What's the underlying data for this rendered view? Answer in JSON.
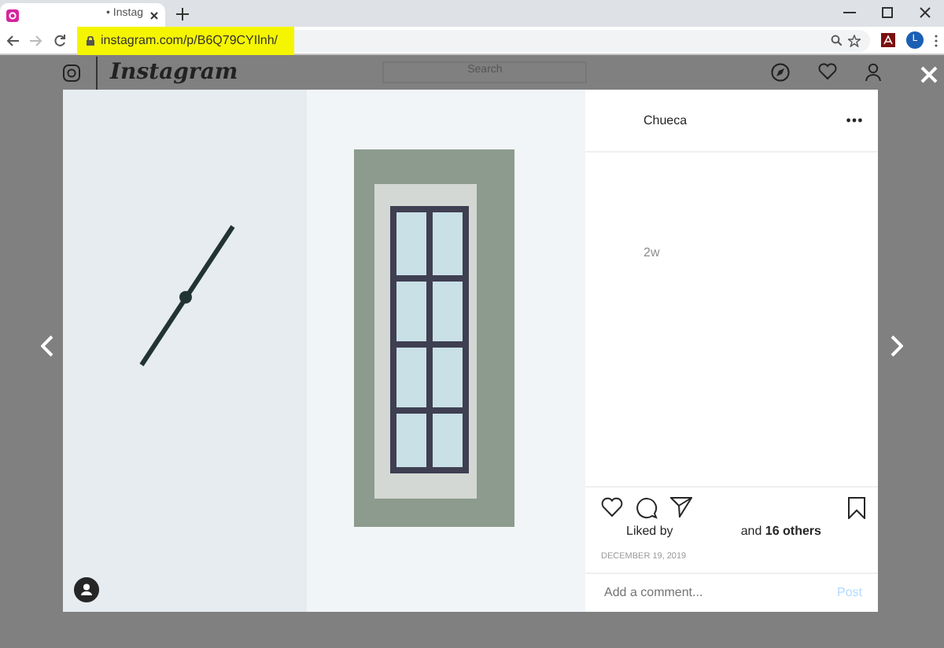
{
  "browser": {
    "tab": {
      "title": "• Instag"
    },
    "url": "instagram.com/p/B6Q79CYIlnh/",
    "account_initial": "L"
  },
  "header": {
    "logo": "Instagram",
    "search": {
      "placeholder": "Search"
    }
  },
  "post": {
    "location": "Chueca",
    "time": "2w",
    "liked_by": "Liked by",
    "likes": "and **16 others**",
    "date": "DECEMBER 19, 2019",
    "comment": {
      "placeholder": "Add a comment..."
    },
    "post_button": {
      "label": "Post",
      "disabled": true
    }
  }
}
